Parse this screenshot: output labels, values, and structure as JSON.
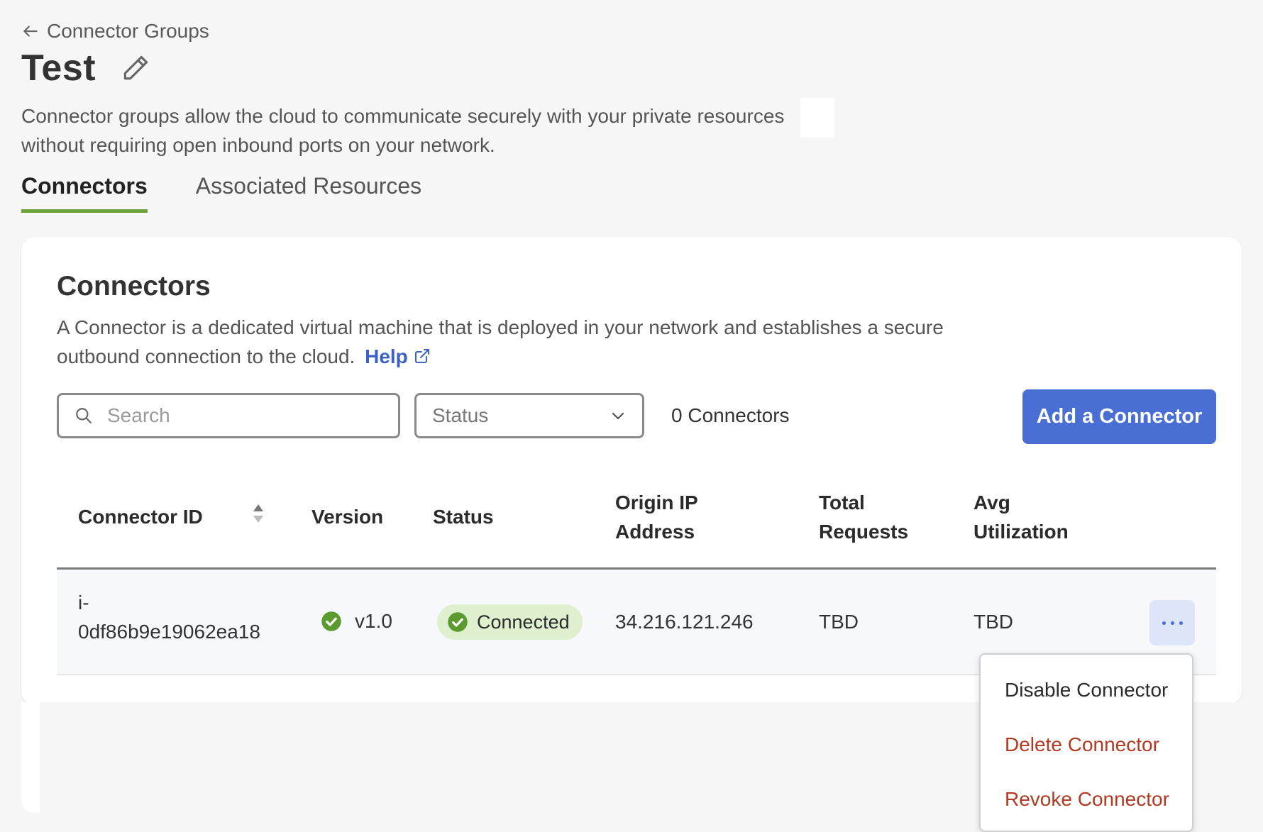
{
  "breadcrumb": {
    "label": "Connector Groups"
  },
  "page": {
    "title": "Test",
    "description": "Connector groups allow the  cloud to communicate securely with your private resources without requiring open inbound ports on your network."
  },
  "tabs": [
    {
      "label": "Connectors",
      "active": true
    },
    {
      "label": "Associated Resources",
      "active": false
    }
  ],
  "card": {
    "title": "Connectors",
    "description": "A Connector is a dedicated virtual machine that is deployed in your network and establishes a secure outbound connection to the  cloud.",
    "help_label": "Help"
  },
  "toolbar": {
    "search_placeholder": "Search",
    "status_label": "Status",
    "count_label": "0 Connectors",
    "add_button_label": "Add a Connector"
  },
  "table": {
    "headers": {
      "connector_id": "Connector ID",
      "version": "Version",
      "status": "Status",
      "origin_ip_line1": "Origin IP",
      "origin_ip_line2": "Address",
      "total_requests_line1": "Total",
      "total_requests_line2": "Requests",
      "avg_util_line1": "Avg",
      "avg_util_line2": "Utilization"
    },
    "rows": [
      {
        "connector_id_line1": "i-",
        "connector_id_line2": "0df86b9e19062ea18",
        "version": "v1.0",
        "status": "Connected",
        "origin_ip": "34.216.121.246",
        "total_requests": "TBD",
        "avg_utilization": "TBD"
      }
    ]
  },
  "row_menu": {
    "items": [
      {
        "label": "Disable Connector",
        "style": "normal"
      },
      {
        "label": "Delete Connector",
        "style": "danger"
      },
      {
        "label": "Revoke Connector",
        "style": "danger"
      }
    ]
  },
  "colors": {
    "accent": "#4a6fd4",
    "tab_underline": "#6aa13a",
    "status_green": "#5a9a2e",
    "status_badge_bg": "#dff0cf",
    "danger": "#b13a23"
  },
  "icons": [
    "back-arrow-icon",
    "pencil-edit-icon",
    "external-link-icon",
    "search-icon",
    "chevron-down-icon",
    "sort-icon",
    "check-circle-icon",
    "more-horizontal-icon"
  ]
}
